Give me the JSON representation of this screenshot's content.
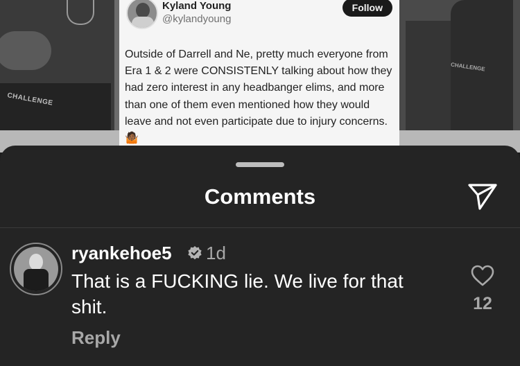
{
  "background_post": {
    "shorts_text_left": "CHALLENGE",
    "shorts_text_right": "CHALLENGE",
    "tweet": {
      "author_name": "Kyland Young",
      "author_handle": "@kylandyoung",
      "follow_label": "Follow",
      "text": "Outside of Darrell and Ne, pretty much everyone from Era 1 & 2 were CONSISTENLY talking about how they had zero interest in any headbanger elims, and more than one of them even mentioned how they would leave and not even participate due to injury concerns. 🤷🏾"
    }
  },
  "sheet": {
    "title": "Comments",
    "share_icon": "send-icon"
  },
  "comments": [
    {
      "username": "ryankehoe5",
      "verified": true,
      "time": "1d",
      "text": "That is a FUCKING lie. We live for that shit.",
      "reply_label": "Reply",
      "like_count": "12",
      "like_icon": "heart-outline-icon"
    }
  ],
  "colors": {
    "sheet_bg": "#242424",
    "primary_text": "#ffffff",
    "secondary_text": "#a8a8a8"
  }
}
